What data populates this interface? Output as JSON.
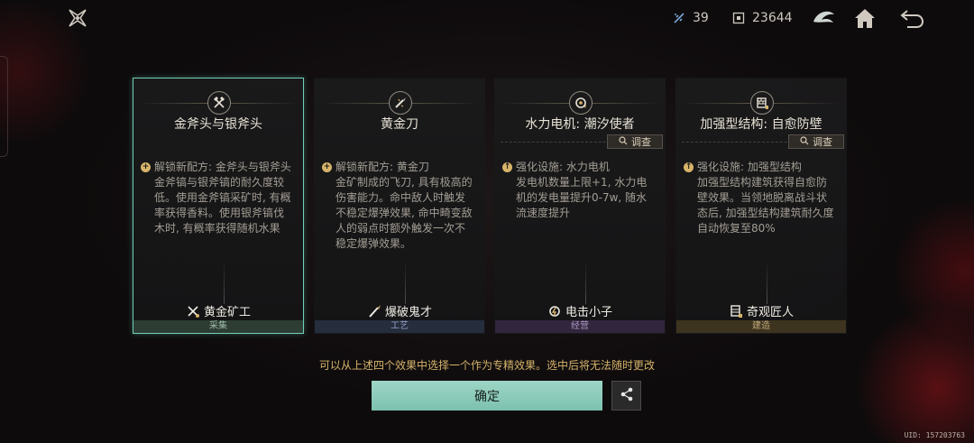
{
  "header": {
    "resource_1": {
      "icon": "sparkle-icon",
      "value": "39"
    },
    "resource_2": {
      "icon": "coin-box-icon",
      "value": "23644"
    },
    "buttons": [
      "emblem-icon",
      "home-icon",
      "back-icon"
    ]
  },
  "cards": [
    {
      "title": "金斧头与银斧头",
      "icon": "crossed-axes-icon",
      "selected": true,
      "has_inspect": false,
      "effect_head": "解锁新配方: 金斧头与银斧头",
      "effect_body": "金斧镐与银斧镐的耐久度较低。使用金斧镐采矿时, 有概率获得香料。使用银斧镐伐木时, 有概率获得随机水果",
      "hero": "黄金矿工",
      "category": "采集",
      "category_color": "#4b6e5a"
    },
    {
      "title": "黄金刀",
      "icon": "throwing-knife-icon",
      "selected": false,
      "has_inspect": false,
      "effect_head": "解锁新配方: 黄金刀",
      "effect_body": "金矿制成的飞刀, 具有极高的伤害能力。命中敌人时触发不稳定爆弹效果, 命中畸变敌人的弱点时额外触发一次不稳定爆弹效果。",
      "hero": "爆破鬼才",
      "category": "工艺",
      "category_color": "#3c4b6e"
    },
    {
      "title": "水力电机: 潮汐使者",
      "icon": "gear-bolt-icon",
      "selected": false,
      "has_inspect": true,
      "effect_head": "强化设施: 水力电机",
      "effect_body": "发电机数量上限+1, 水力电机的发电量提升0-7w, 随水流速度提升",
      "hero": "电击小子",
      "category": "经营",
      "category_color": "#553c6e"
    },
    {
      "title": "加强型结构: 自愈防壁",
      "icon": "shield-wall-icon",
      "selected": false,
      "has_inspect": true,
      "effect_head": "强化设施: 加强型结构",
      "effect_body": "加强型结构建筑获得自愈防壁效果。当领地脱离战斗状态后, 加强型结构建筑耐久度自动恢复至80%",
      "hero": "奇观匠人",
      "category": "建造",
      "category_color": "#6e5a2d"
    }
  ],
  "inspect_label": "调查",
  "notice": "可以从上述四个效果中选择一个作为专精效果。选中后将无法随时更改",
  "confirm_label": "确定",
  "uid": "UID: 157203763"
}
